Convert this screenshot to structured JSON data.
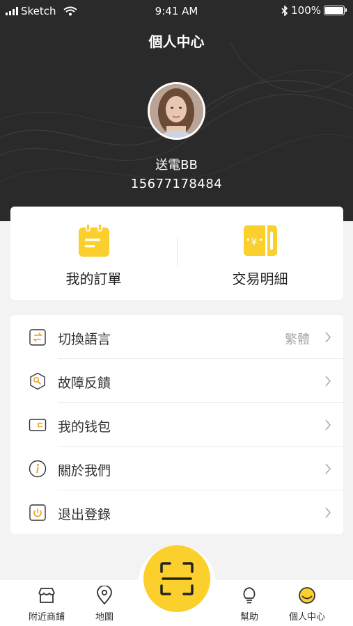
{
  "status_bar": {
    "carrier": "Sketch",
    "time": "9:41 AM",
    "battery": "100%"
  },
  "header": {
    "title": "個人中心"
  },
  "profile": {
    "name": "送電BB",
    "phone": "15677178484"
  },
  "quick_actions": [
    {
      "label": "我的訂單",
      "icon": "order-clipboard-icon"
    },
    {
      "label": "交易明細",
      "icon": "transaction-ticket-icon"
    }
  ],
  "menu": [
    {
      "label": "切換語言",
      "value": "繁體",
      "icon": "language-switch-icon"
    },
    {
      "label": "故障反饋",
      "value": "",
      "icon": "feedback-wrench-icon"
    },
    {
      "label": "我的钱包",
      "value": "",
      "icon": "wallet-icon"
    },
    {
      "label": "關於我們",
      "value": "",
      "icon": "info-icon"
    },
    {
      "label": "退出登錄",
      "value": "",
      "icon": "power-icon"
    }
  ],
  "tabbar": [
    {
      "label": "附近商鋪",
      "icon": "shop-icon"
    },
    {
      "label": "地圖",
      "icon": "map-pin-icon"
    },
    {
      "label": "幫助",
      "icon": "lightbulb-icon"
    },
    {
      "label": "個人中心",
      "icon": "profile-icon"
    }
  ],
  "colors": {
    "accent": "#fbd02c",
    "header_bg": "#2a2a2a"
  }
}
